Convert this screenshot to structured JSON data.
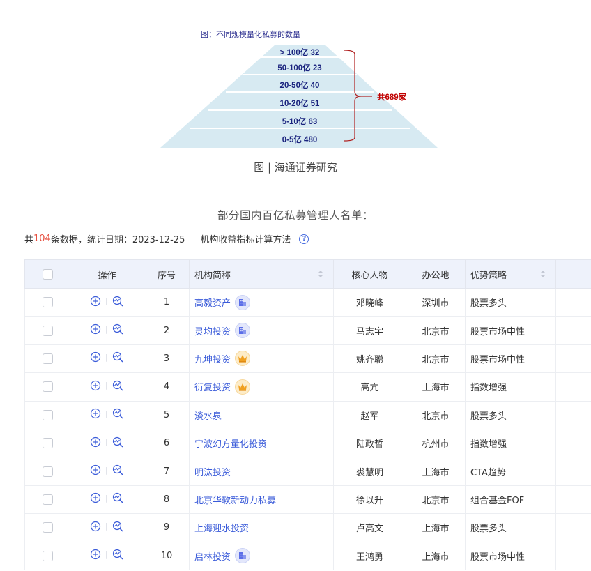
{
  "figure": {
    "title": "图：不同规模量化私募的数量",
    "tiers": [
      {
        "label": "> 100亿 32"
      },
      {
        "label": "50-100亿 23"
      },
      {
        "label": "20-50亿 40"
      },
      {
        "label": "10-20亿 51"
      },
      {
        "label": "5-10亿 63"
      },
      {
        "label": "0-5亿 480"
      }
    ],
    "total_label": "共689家",
    "caption": "图 | 海通证券研究",
    "colors": {
      "pyramid_fill": "#d7eaf2",
      "title_color": "#2b2e8f",
      "tier_text": "#1a237e",
      "total_color": "#c00000"
    }
  },
  "section_title": "部分国内百亿私募管理人名单：",
  "summary": {
    "prefix": "共 ",
    "count": "104",
    "suffix": " 条数据，统计日期：2023-12-25",
    "method_link": "机构收益指标计算方法",
    "help_glyph": "?"
  },
  "table": {
    "headers": {
      "ops": "操作",
      "index": "序号",
      "org": "机构简称",
      "person": "核心人物",
      "city": "办公地",
      "strategy": "优势策略"
    },
    "rows": [
      {
        "index": "1",
        "org": "高毅资产",
        "badge": "building-icon",
        "person": "邓晓峰",
        "city": "深圳市",
        "strategy": "股票多头"
      },
      {
        "index": "2",
        "org": "灵均投资",
        "badge": "building-icon",
        "person": "马志宇",
        "city": "北京市",
        "strategy": "股票市场中性"
      },
      {
        "index": "3",
        "org": "九坤投资",
        "badge": "crown-icon",
        "person": "姚齐聪",
        "city": "北京市",
        "strategy": "股票市场中性"
      },
      {
        "index": "4",
        "org": "衍复投资",
        "badge": "crown-icon",
        "person": "高亢",
        "city": "上海市",
        "strategy": "指数增强"
      },
      {
        "index": "5",
        "org": "淡水泉",
        "badge": "",
        "person": "赵军",
        "city": "北京市",
        "strategy": "股票多头"
      },
      {
        "index": "6",
        "org": "宁波幻方量化投资",
        "badge": "",
        "person": "陆政哲",
        "city": "杭州市",
        "strategy": "指数增强"
      },
      {
        "index": "7",
        "org": "明汯投资",
        "badge": "",
        "person": "裘慧明",
        "city": "上海市",
        "strategy": "CTA趋势"
      },
      {
        "index": "8",
        "org": "北京华软新动力私募",
        "badge": "",
        "person": "徐以升",
        "city": "北京市",
        "strategy": "组合基金FOF"
      },
      {
        "index": "9",
        "org": "上海迎水投资",
        "badge": "",
        "person": "卢高文",
        "city": "上海市",
        "strategy": "股票多头"
      },
      {
        "index": "10",
        "org": "启林投资",
        "badge": "building-icon",
        "person": "王鸿勇",
        "city": "上海市",
        "strategy": "股票市场中性"
      }
    ]
  }
}
